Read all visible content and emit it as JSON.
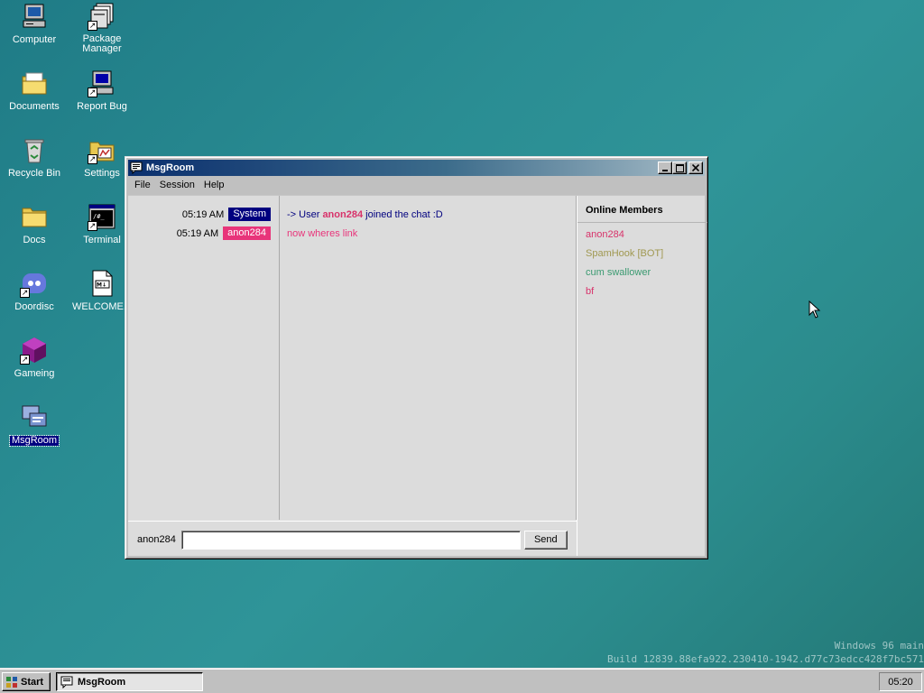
{
  "desktop": {
    "icons": [
      {
        "label": "Computer",
        "icon": "computer-icon"
      },
      {
        "label": "Package Manager",
        "icon": "package-manager-icon"
      },
      {
        "label": "Documents",
        "icon": "documents-folder-icon"
      },
      {
        "label": "Report Bug",
        "icon": "report-bug-icon"
      },
      {
        "label": "Recycle Bin",
        "icon": "recycle-bin-icon"
      },
      {
        "label": "Settings",
        "icon": "settings-icon"
      },
      {
        "label": "Docs",
        "icon": "docs-folder-icon"
      },
      {
        "label": "Terminal",
        "icon": "terminal-icon"
      },
      {
        "label": "Doordisc",
        "icon": "doordisc-icon"
      },
      {
        "label": "WELCOME...",
        "icon": "markdown-file-icon"
      },
      {
        "label": "Gameing",
        "icon": "gameing-cube-icon"
      },
      {
        "label": "MsgRoom",
        "icon": "msgroom-icon"
      }
    ]
  },
  "window": {
    "title": "MsgRoom",
    "menu": [
      "File",
      "Session",
      "Help"
    ],
    "messages": [
      {
        "time": "05:19 AM",
        "user": "System",
        "user_color": "#00007f",
        "parts": [
          "-> User ",
          "anon284",
          " joined the chat :D"
        ]
      },
      {
        "time": "05:19 AM",
        "user": "anon284",
        "user_color": "#e8347a",
        "text": "now wheres link",
        "text_color": "#e8347a"
      }
    ],
    "members_title": "Online Members",
    "members": [
      {
        "name": "anon284",
        "color": "#d8326a"
      },
      {
        "name": "SpamHook [BOT]",
        "color": "#a09850"
      },
      {
        "name": "cum swallower",
        "color": "#3a9a70"
      },
      {
        "name": "bf",
        "color": "#d8326a"
      }
    ],
    "input": {
      "nick": "anon284",
      "value": "",
      "send_label": "Send"
    }
  },
  "watermark": {
    "line1": "Windows 96 main",
    "line2": "Build 12839.88efa922.230410-1942.d77c73edcc428f7bc571"
  },
  "taskbar": {
    "start_label": "Start",
    "task_label": "MsgRoom",
    "clock": "05:20"
  },
  "colors": {
    "system_badge": "#00007f",
    "user_accent": "#e8347a",
    "desktop_teal": "#2a8d93"
  }
}
